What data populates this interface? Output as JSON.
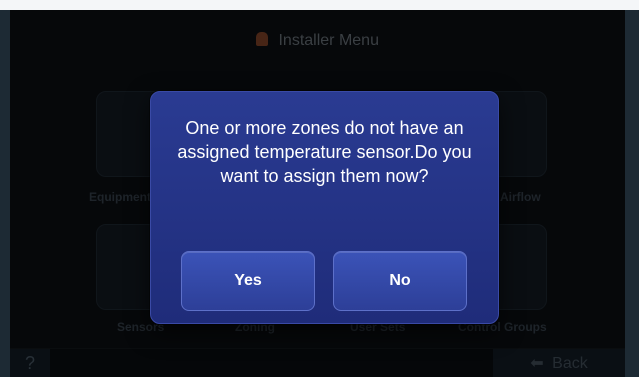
{
  "header": {
    "title": "Installer Menu",
    "icon": "chef-hat-icon"
  },
  "tiles": [
    {
      "label": "Equipment",
      "icon": "equipment-icon"
    },
    {
      "label": "",
      "icon": "blank-icon"
    },
    {
      "label": "",
      "icon": "blank-icon"
    },
    {
      "label": "Airflow",
      "icon": "airflow-icon"
    },
    {
      "label": "Sensors",
      "icon": "wifi-icon"
    },
    {
      "label": "Zoning",
      "icon": "zoning-icon"
    },
    {
      "label": "User Sets",
      "icon": "user-sets-icon"
    },
    {
      "label": "Control Groups",
      "icon": "control-groups-icon"
    }
  ],
  "footer": {
    "help_label": "?",
    "back_label": "Back"
  },
  "dialog": {
    "message": "One or more zones do not have an assigned temperature sensor.Do you want to assign them now?",
    "yes_label": "Yes",
    "no_label": "No"
  },
  "colors": {
    "dialog_background": "#23328a",
    "button_background": "#344aa9",
    "text": "#ffffff"
  }
}
